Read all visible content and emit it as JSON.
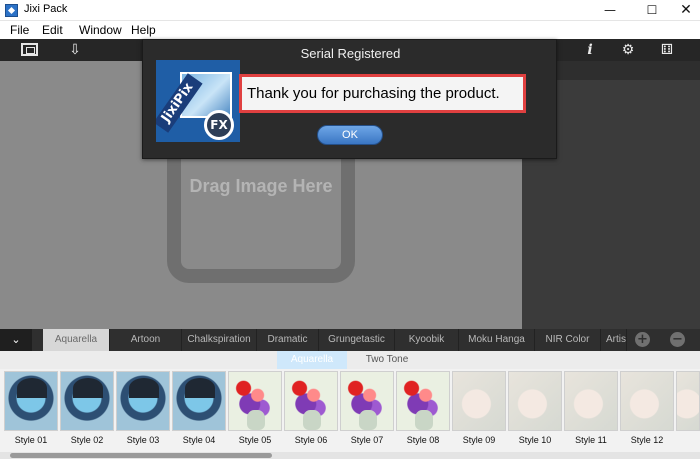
{
  "window": {
    "title": "Jixi Pack",
    "minimize": "—",
    "maximize": "☐",
    "close": "✕"
  },
  "menu": {
    "items": [
      "File",
      "Edit",
      "Window",
      "Help"
    ]
  },
  "toolbar": {
    "left_icons": [
      "frame-icon",
      "save-tray-icon"
    ],
    "right_icons": [
      "info-icon",
      "settings-icon",
      "dice-icon"
    ],
    "info_glyph": "i",
    "gear_glyph": "⚙",
    "dice_glyph": "⚅",
    "save_glyph": "⇩"
  },
  "canvas": {
    "drop_text": "Drag Image Here"
  },
  "dialog": {
    "title": "Serial Registered",
    "logo_band": "JixiPix",
    "logo_badge": "FX",
    "message": "Thank you for purchasing the product.",
    "ok_label": "OK",
    "highlight_color": "#e04040"
  },
  "categories": {
    "toggle": "⌄",
    "tabs": [
      "Aquarella",
      "Artoon",
      "Chalkspiration",
      "Dramatic",
      "Grungetastic",
      "Kyoobik",
      "Moku Hanga",
      "NIR Color",
      "Artis"
    ],
    "active": "Aquarella",
    "add": "+",
    "remove": "−"
  },
  "subtabs": {
    "tabs": [
      "Aquarella",
      "Two Tone"
    ],
    "active": "Aquarella"
  },
  "styles": {
    "thumbnails": [
      {
        "label": "Style 01",
        "kind": "portrait"
      },
      {
        "label": "Style 02",
        "kind": "portrait"
      },
      {
        "label": "Style 03",
        "kind": "portrait"
      },
      {
        "label": "Style 04",
        "kind": "portrait"
      },
      {
        "label": "Style 05",
        "kind": "flowers"
      },
      {
        "label": "Style 06",
        "kind": "flowers"
      },
      {
        "label": "Style 07",
        "kind": "flowers"
      },
      {
        "label": "Style 08",
        "kind": "flowers"
      },
      {
        "label": "Style 09",
        "kind": "orchid"
      },
      {
        "label": "Style 10",
        "kind": "orchid"
      },
      {
        "label": "Style 11",
        "kind": "orchid"
      },
      {
        "label": "Style 12",
        "kind": "orchid"
      },
      {
        "label": "",
        "kind": "orchid"
      }
    ]
  }
}
